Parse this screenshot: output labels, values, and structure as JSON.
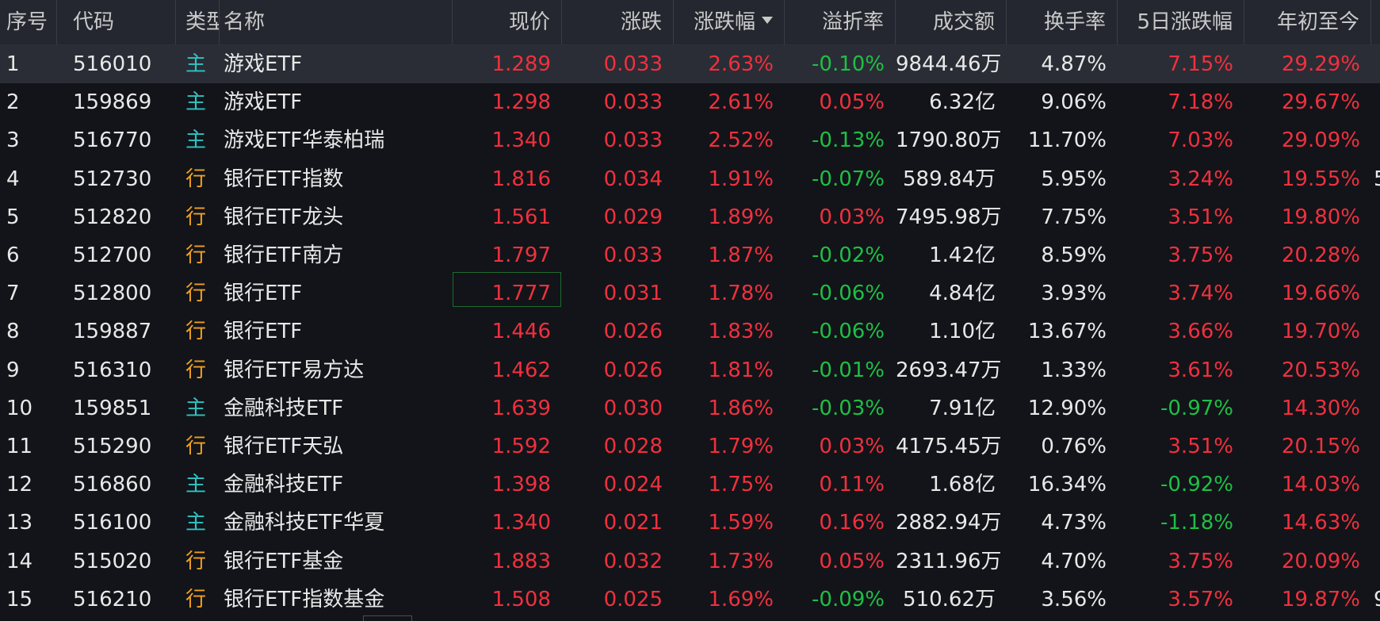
{
  "columns": [
    {
      "key": "seq",
      "label": "序号"
    },
    {
      "key": "code",
      "label": "代码"
    },
    {
      "key": "type",
      "label": "类型"
    },
    {
      "key": "name",
      "label": "名称"
    },
    {
      "key": "price",
      "label": "现价"
    },
    {
      "key": "change",
      "label": "涨跌"
    },
    {
      "key": "pct",
      "label": "涨跌幅"
    },
    {
      "key": "premium",
      "label": "溢折率"
    },
    {
      "key": "amount",
      "label": "成交额"
    },
    {
      "key": "turnover",
      "label": "换手率"
    },
    {
      "key": "d5",
      "label": "5日涨跌幅"
    },
    {
      "key": "ytd",
      "label": "年初至今"
    }
  ],
  "sort_column": "pct",
  "rows": [
    {
      "seq": "1",
      "code": "516010",
      "type": "主",
      "name": "游戏ETF",
      "price": "1.289",
      "change": "0.033",
      "pct": "2.63%",
      "premium": "-0.10%",
      "amount": "9844.46万",
      "turnover": "4.87%",
      "d5": "7.15%",
      "ytd": "29.29%"
    },
    {
      "seq": "2",
      "code": "159869",
      "type": "主",
      "name": "游戏ETF",
      "price": "1.298",
      "change": "0.033",
      "pct": "2.61%",
      "premium": "0.05%",
      "amount": "6.32亿",
      "turnover": "9.06%",
      "d5": "7.18%",
      "ytd": "29.67%"
    },
    {
      "seq": "3",
      "code": "516770",
      "type": "主",
      "name": "游戏ETF华泰柏瑞",
      "price": "1.340",
      "change": "0.033",
      "pct": "2.52%",
      "premium": "-0.13%",
      "amount": "1790.80万",
      "turnover": "11.70%",
      "d5": "7.03%",
      "ytd": "29.09%"
    },
    {
      "seq": "4",
      "code": "512730",
      "type": "行",
      "name": "银行ETF指数",
      "price": "1.816",
      "change": "0.034",
      "pct": "1.91%",
      "premium": "-0.07%",
      "amount": "589.84万",
      "turnover": "5.95%",
      "d5": "3.24%",
      "ytd": "19.55%",
      "edge": "5"
    },
    {
      "seq": "5",
      "code": "512820",
      "type": "行",
      "name": "银行ETF龙头",
      "price": "1.561",
      "change": "0.029",
      "pct": "1.89%",
      "premium": "0.03%",
      "amount": "7495.98万",
      "turnover": "7.75%",
      "d5": "3.51%",
      "ytd": "19.80%"
    },
    {
      "seq": "6",
      "code": "512700",
      "type": "行",
      "name": "银行ETF南方",
      "price": "1.797",
      "change": "0.033",
      "pct": "1.87%",
      "premium": "-0.02%",
      "amount": "1.42亿",
      "turnover": "8.59%",
      "d5": "3.75%",
      "ytd": "20.28%"
    },
    {
      "seq": "7",
      "code": "512800",
      "type": "行",
      "name": "银行ETF",
      "price": "1.777",
      "change": "0.031",
      "pct": "1.78%",
      "premium": "-0.06%",
      "amount": "4.84亿",
      "turnover": "3.93%",
      "d5": "3.74%",
      "ytd": "19.66%"
    },
    {
      "seq": "8",
      "code": "159887",
      "type": "行",
      "name": "银行ETF",
      "price": "1.446",
      "change": "0.026",
      "pct": "1.83%",
      "premium": "-0.06%",
      "amount": "1.10亿",
      "turnover": "13.67%",
      "d5": "3.66%",
      "ytd": "19.70%"
    },
    {
      "seq": "9",
      "code": "516310",
      "type": "行",
      "name": "银行ETF易方达",
      "price": "1.462",
      "change": "0.026",
      "pct": "1.81%",
      "premium": "-0.01%",
      "amount": "2693.47万",
      "turnover": "1.33%",
      "d5": "3.61%",
      "ytd": "20.53%"
    },
    {
      "seq": "10",
      "code": "159851",
      "type": "主",
      "name": "金融科技ETF",
      "price": "1.639",
      "change": "0.030",
      "pct": "1.86%",
      "premium": "-0.03%",
      "amount": "7.91亿",
      "turnover": "12.90%",
      "d5": "-0.97%",
      "ytd": "14.30%"
    },
    {
      "seq": "11",
      "code": "515290",
      "type": "行",
      "name": "银行ETF天弘",
      "price": "1.592",
      "change": "0.028",
      "pct": "1.79%",
      "premium": "0.03%",
      "amount": "4175.45万",
      "turnover": "0.76%",
      "d5": "3.51%",
      "ytd": "20.15%"
    },
    {
      "seq": "12",
      "code": "516860",
      "type": "主",
      "name": "金融科技ETF",
      "price": "1.398",
      "change": "0.024",
      "pct": "1.75%",
      "premium": "0.11%",
      "amount": "1.68亿",
      "turnover": "16.34%",
      "d5": "-0.92%",
      "ytd": "14.03%"
    },
    {
      "seq": "13",
      "code": "516100",
      "type": "主",
      "name": "金融科技ETF华夏",
      "price": "1.340",
      "change": "0.021",
      "pct": "1.59%",
      "premium": "0.16%",
      "amount": "2882.94万",
      "turnover": "4.73%",
      "d5": "-1.18%",
      "ytd": "14.63%"
    },
    {
      "seq": "14",
      "code": "515020",
      "type": "行",
      "name": "银行ETF基金",
      "price": "1.883",
      "change": "0.032",
      "pct": "1.73%",
      "premium": "0.05%",
      "amount": "2311.96万",
      "turnover": "4.70%",
      "d5": "3.75%",
      "ytd": "20.09%"
    },
    {
      "seq": "15",
      "code": "516210",
      "type": "行",
      "name": "银行ETF指数基金",
      "price": "1.508",
      "change": "0.025",
      "pct": "1.69%",
      "premium": "-0.09%",
      "amount": "510.62万",
      "turnover": "3.56%",
      "d5": "3.57%",
      "ytd": "19.87%",
      "edge": "9"
    }
  ],
  "selected_row": 0,
  "focused_cell": {
    "row": 6,
    "column": "price"
  },
  "colors": {
    "up": "#f0303e",
    "down": "#1fbf45",
    "type_main": "#2ec4c4",
    "type_industry": "#f0a020"
  }
}
